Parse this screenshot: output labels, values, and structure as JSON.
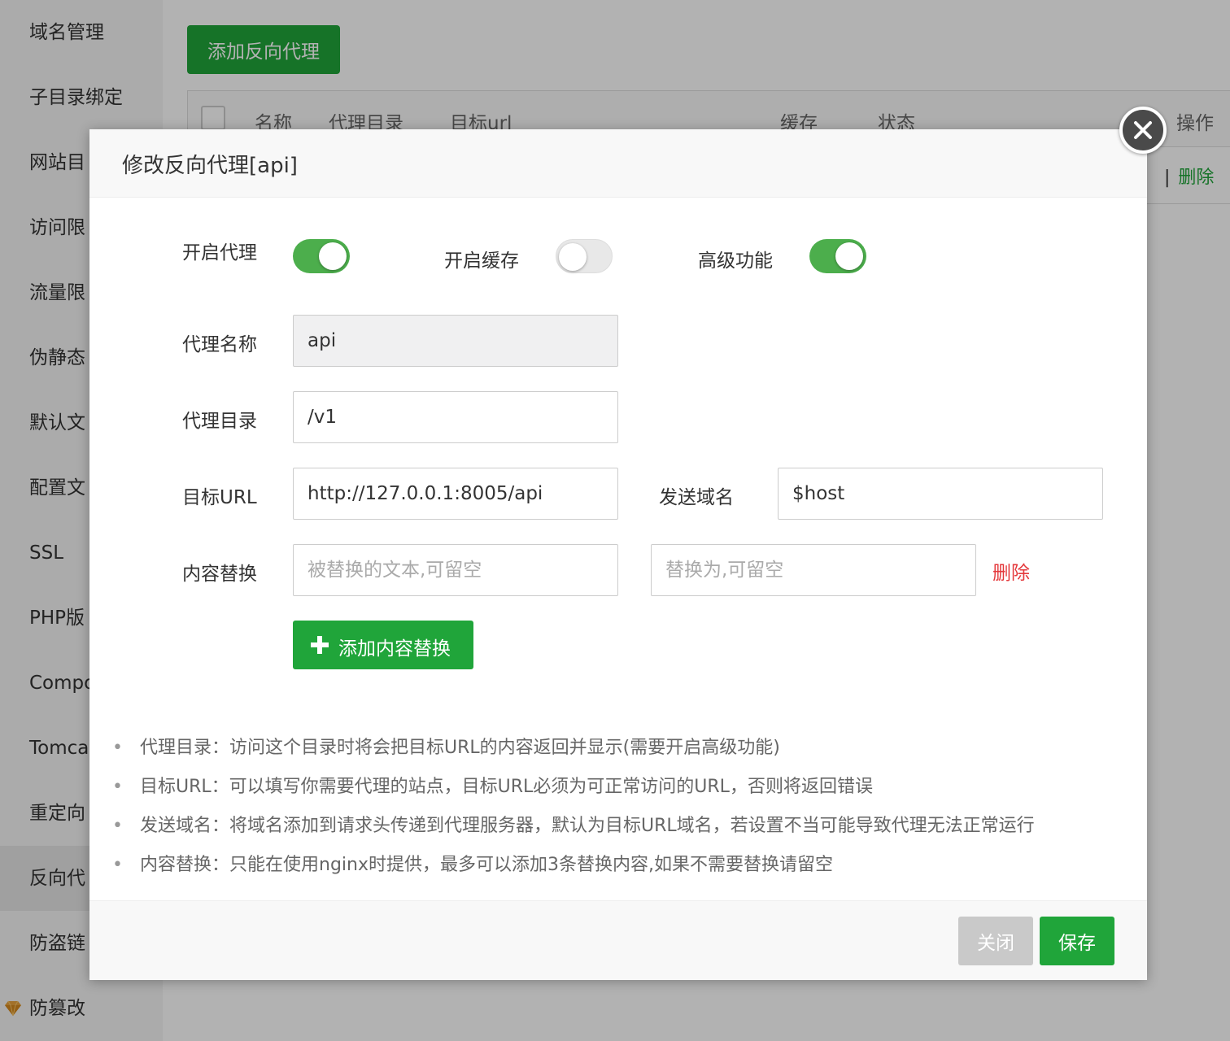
{
  "sidebar": {
    "items": [
      {
        "label": "域名管理"
      },
      {
        "label": "子目录绑定"
      },
      {
        "label": "网站目"
      },
      {
        "label": "访问限"
      },
      {
        "label": "流量限"
      },
      {
        "label": "伪静态"
      },
      {
        "label": "默认文"
      },
      {
        "label": "配置文"
      },
      {
        "label": "SSL"
      },
      {
        "label": "PHP版"
      },
      {
        "label": "Compo"
      },
      {
        "label": "Tomcat"
      },
      {
        "label": "重定向"
      },
      {
        "label": "反向代"
      },
      {
        "label": "防盗链"
      },
      {
        "label": "防篡改"
      }
    ],
    "active_index": 13
  },
  "toolbar": {
    "add_proxy_label": "添加反向代理"
  },
  "table": {
    "headers": [
      "名称",
      "代理目录",
      "目标url",
      "缓存",
      "状态",
      "操作"
    ],
    "row_actions": {
      "separator": "|",
      "delete": "删除"
    }
  },
  "modal": {
    "title": "修改反向代理[api]",
    "toggles": {
      "proxy": {
        "label": "开启代理",
        "on": true
      },
      "cache": {
        "label": "开启缓存",
        "on": false
      },
      "advanced": {
        "label": "高级功能",
        "on": true
      }
    },
    "fields": {
      "name": {
        "label": "代理名称",
        "value": "api"
      },
      "dir": {
        "label": "代理目录",
        "value": "/v1"
      },
      "url": {
        "label": "目标URL",
        "value": "http://127.0.0.1:8005/api"
      },
      "send_domain": {
        "label": "发送域名",
        "value": "$host"
      },
      "replace": {
        "label": "内容替换",
        "from_placeholder": "被替换的文本,可留空",
        "to_placeholder": "替换为,可留空",
        "delete_label": "删除"
      }
    },
    "add_replace_label": "添加内容替换",
    "tips": [
      "代理目录：访问这个目录时将会把目标URL的内容返回并显示(需要开启高级功能)",
      "目标URL：可以填写你需要代理的站点，目标URL必须为可正常访问的URL，否则将返回错误",
      "发送域名：将域名添加到请求头传递到代理服务器，默认为目标URL域名，若设置不当可能导致代理无法正常运行",
      "内容替换：只能在使用nginx时提供，最多可以添加3条替换内容,如果不需要替换请留空"
    ],
    "buttons": {
      "close": "关闭",
      "save": "保存"
    }
  },
  "colors": {
    "primary_green": "#20a53a",
    "danger_red": "#e4393c"
  },
  "bullet": "•"
}
